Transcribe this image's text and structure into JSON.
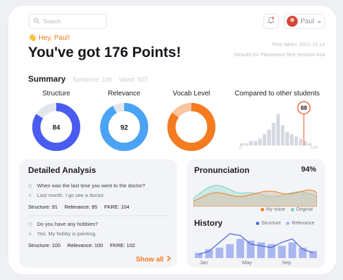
{
  "header": {
    "search_placeholder": "Search",
    "user_name": "Paul"
  },
  "hero": {
    "greeting": "Hey, Paul!",
    "headline": "You've got 176 Points!",
    "time_taken": "Time taken: 2021-11-12",
    "session": "Results for Placement Test Session #14"
  },
  "summary": {
    "title": "Summary",
    "sentence": "Sentence: 145",
    "word": "Word: 307"
  },
  "metrics": [
    {
      "label": "Structure",
      "value": "84",
      "percent": 84,
      "color": "#4a5cf0",
      "track": "#e4e6ee"
    },
    {
      "label": "Relevance",
      "value": "92",
      "percent": 92,
      "color": "#4aa3f5",
      "track": "#e4e6ee"
    },
    {
      "label": "Vocab Level",
      "value": "",
      "percent": 85,
      "color": "#f57b20",
      "track": "#fbc5a0"
    }
  ],
  "comparison": {
    "title": "Compared to other students",
    "score": "88",
    "axis_min": "0",
    "axis_max": "100",
    "distribution": [
      1,
      1,
      2,
      2,
      3,
      5,
      7,
      10,
      14,
      9,
      6,
      5,
      4,
      3,
      2,
      1
    ]
  },
  "analysis": {
    "title": "Detailed Analysis",
    "items": [
      {
        "question": "When was the last time you went to the doctor?",
        "answer": "Last month. I go see a doctor.",
        "structure": "Structure: 91",
        "relevance": "Relevance: 95",
        "fkre": "FKRE: 104"
      },
      {
        "question": "Do you have any hobbies?",
        "answer": "Yes. My hobby is painting.",
        "structure": "Structure: 100",
        "relevance": "Relevance: 100",
        "fkre": "FKRE: 102"
      }
    ],
    "q_mark": "Q",
    "a_mark": "A",
    "show_all": "Show all"
  },
  "pronunciation": {
    "title": "Pronunciation",
    "percent": "94%",
    "legend_voice": "My voice",
    "legend_original": "Original",
    "voice_color": "#f57b20",
    "original_color": "#7fd1c2"
  },
  "history": {
    "title": "History",
    "legend_structure": "Structure",
    "legend_relevance": "Relevance",
    "structure_color": "#4a6be0",
    "relevance_color": "#a9b6f0",
    "months": [
      "Jan",
      "May",
      "Sep"
    ],
    "bars": [
      3,
      5,
      6,
      8,
      11,
      10,
      9,
      8,
      7,
      9,
      6,
      4
    ],
    "line": [
      2,
      4,
      9,
      14,
      13,
      8,
      7,
      6,
      9,
      11,
      5,
      3
    ]
  }
}
